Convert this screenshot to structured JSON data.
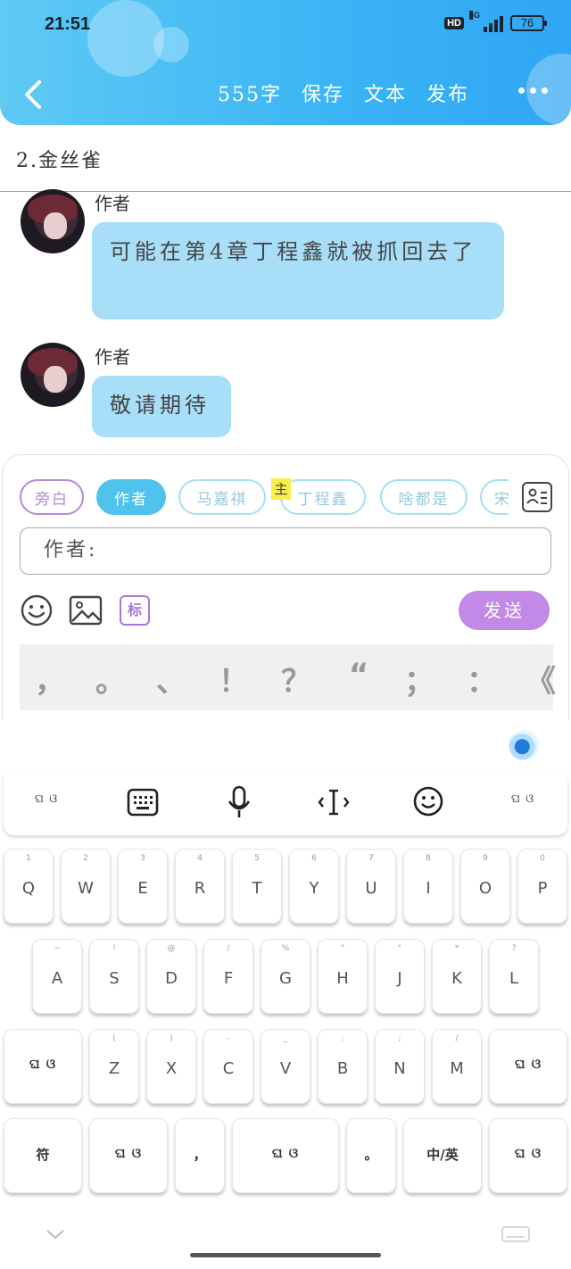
{
  "status_bar": {
    "time": "21:51",
    "hd": "HD",
    "network": "4G",
    "battery": "76"
  },
  "toolbar": {
    "word_count": "555字",
    "save": "保存",
    "text": "文本",
    "publish": "发布"
  },
  "chapter_title": "2.金丝雀",
  "messages": [
    {
      "sender": "作者",
      "text": "可能在第4章丁程鑫就被抓回去了"
    },
    {
      "sender": "作者",
      "text": "敬请期待"
    }
  ],
  "roles": [
    {
      "label": "旁白"
    },
    {
      "label": "作者"
    },
    {
      "label": "马嘉祺"
    },
    {
      "label": "丁程鑫"
    },
    {
      "label": "啥都是"
    },
    {
      "label": "宋"
    }
  ],
  "main_tag": "主",
  "input": {
    "value": "作者:"
  },
  "tag_button": "标",
  "send_button": "发送",
  "punctuation": [
    "，",
    "。",
    "、",
    "！",
    "？",
    "“",
    "；",
    "：",
    "《"
  ],
  "keyboard": {
    "row1": [
      {
        "k": "Q",
        "h": "1"
      },
      {
        "k": "W",
        "h": "2"
      },
      {
        "k": "E",
        "h": "3"
      },
      {
        "k": "R",
        "h": "4"
      },
      {
        "k": "T",
        "h": "5"
      },
      {
        "k": "Y",
        "h": "6"
      },
      {
        "k": "U",
        "h": "7"
      },
      {
        "k": "I",
        "h": "8"
      },
      {
        "k": "O",
        "h": "9"
      },
      {
        "k": "P",
        "h": "0"
      }
    ],
    "row2": [
      {
        "k": "A",
        "h": "~"
      },
      {
        "k": "S",
        "h": "!"
      },
      {
        "k": "D",
        "h": "@"
      },
      {
        "k": "F",
        "h": "/"
      },
      {
        "k": "G",
        "h": "%"
      },
      {
        "k": "H",
        "h": "\""
      },
      {
        "k": "J",
        "h": "\""
      },
      {
        "k": "K",
        "h": "*"
      },
      {
        "k": "L",
        "h": "?"
      }
    ],
    "row3": [
      {
        "k": "Z",
        "h": "("
      },
      {
        "k": "X",
        "h": ")"
      },
      {
        "k": "C",
        "h": "-"
      },
      {
        "k": "V",
        "h": "_"
      },
      {
        "k": "B",
        "h": ":"
      },
      {
        "k": "N",
        "h": ";"
      },
      {
        "k": "M",
        "h": "/"
      }
    ],
    "symbols": "符",
    "comma": "，",
    "period": "。",
    "lang_switch": "中/英",
    "wings": "ଘ(੭ˊᵕˋ)੭"
  }
}
